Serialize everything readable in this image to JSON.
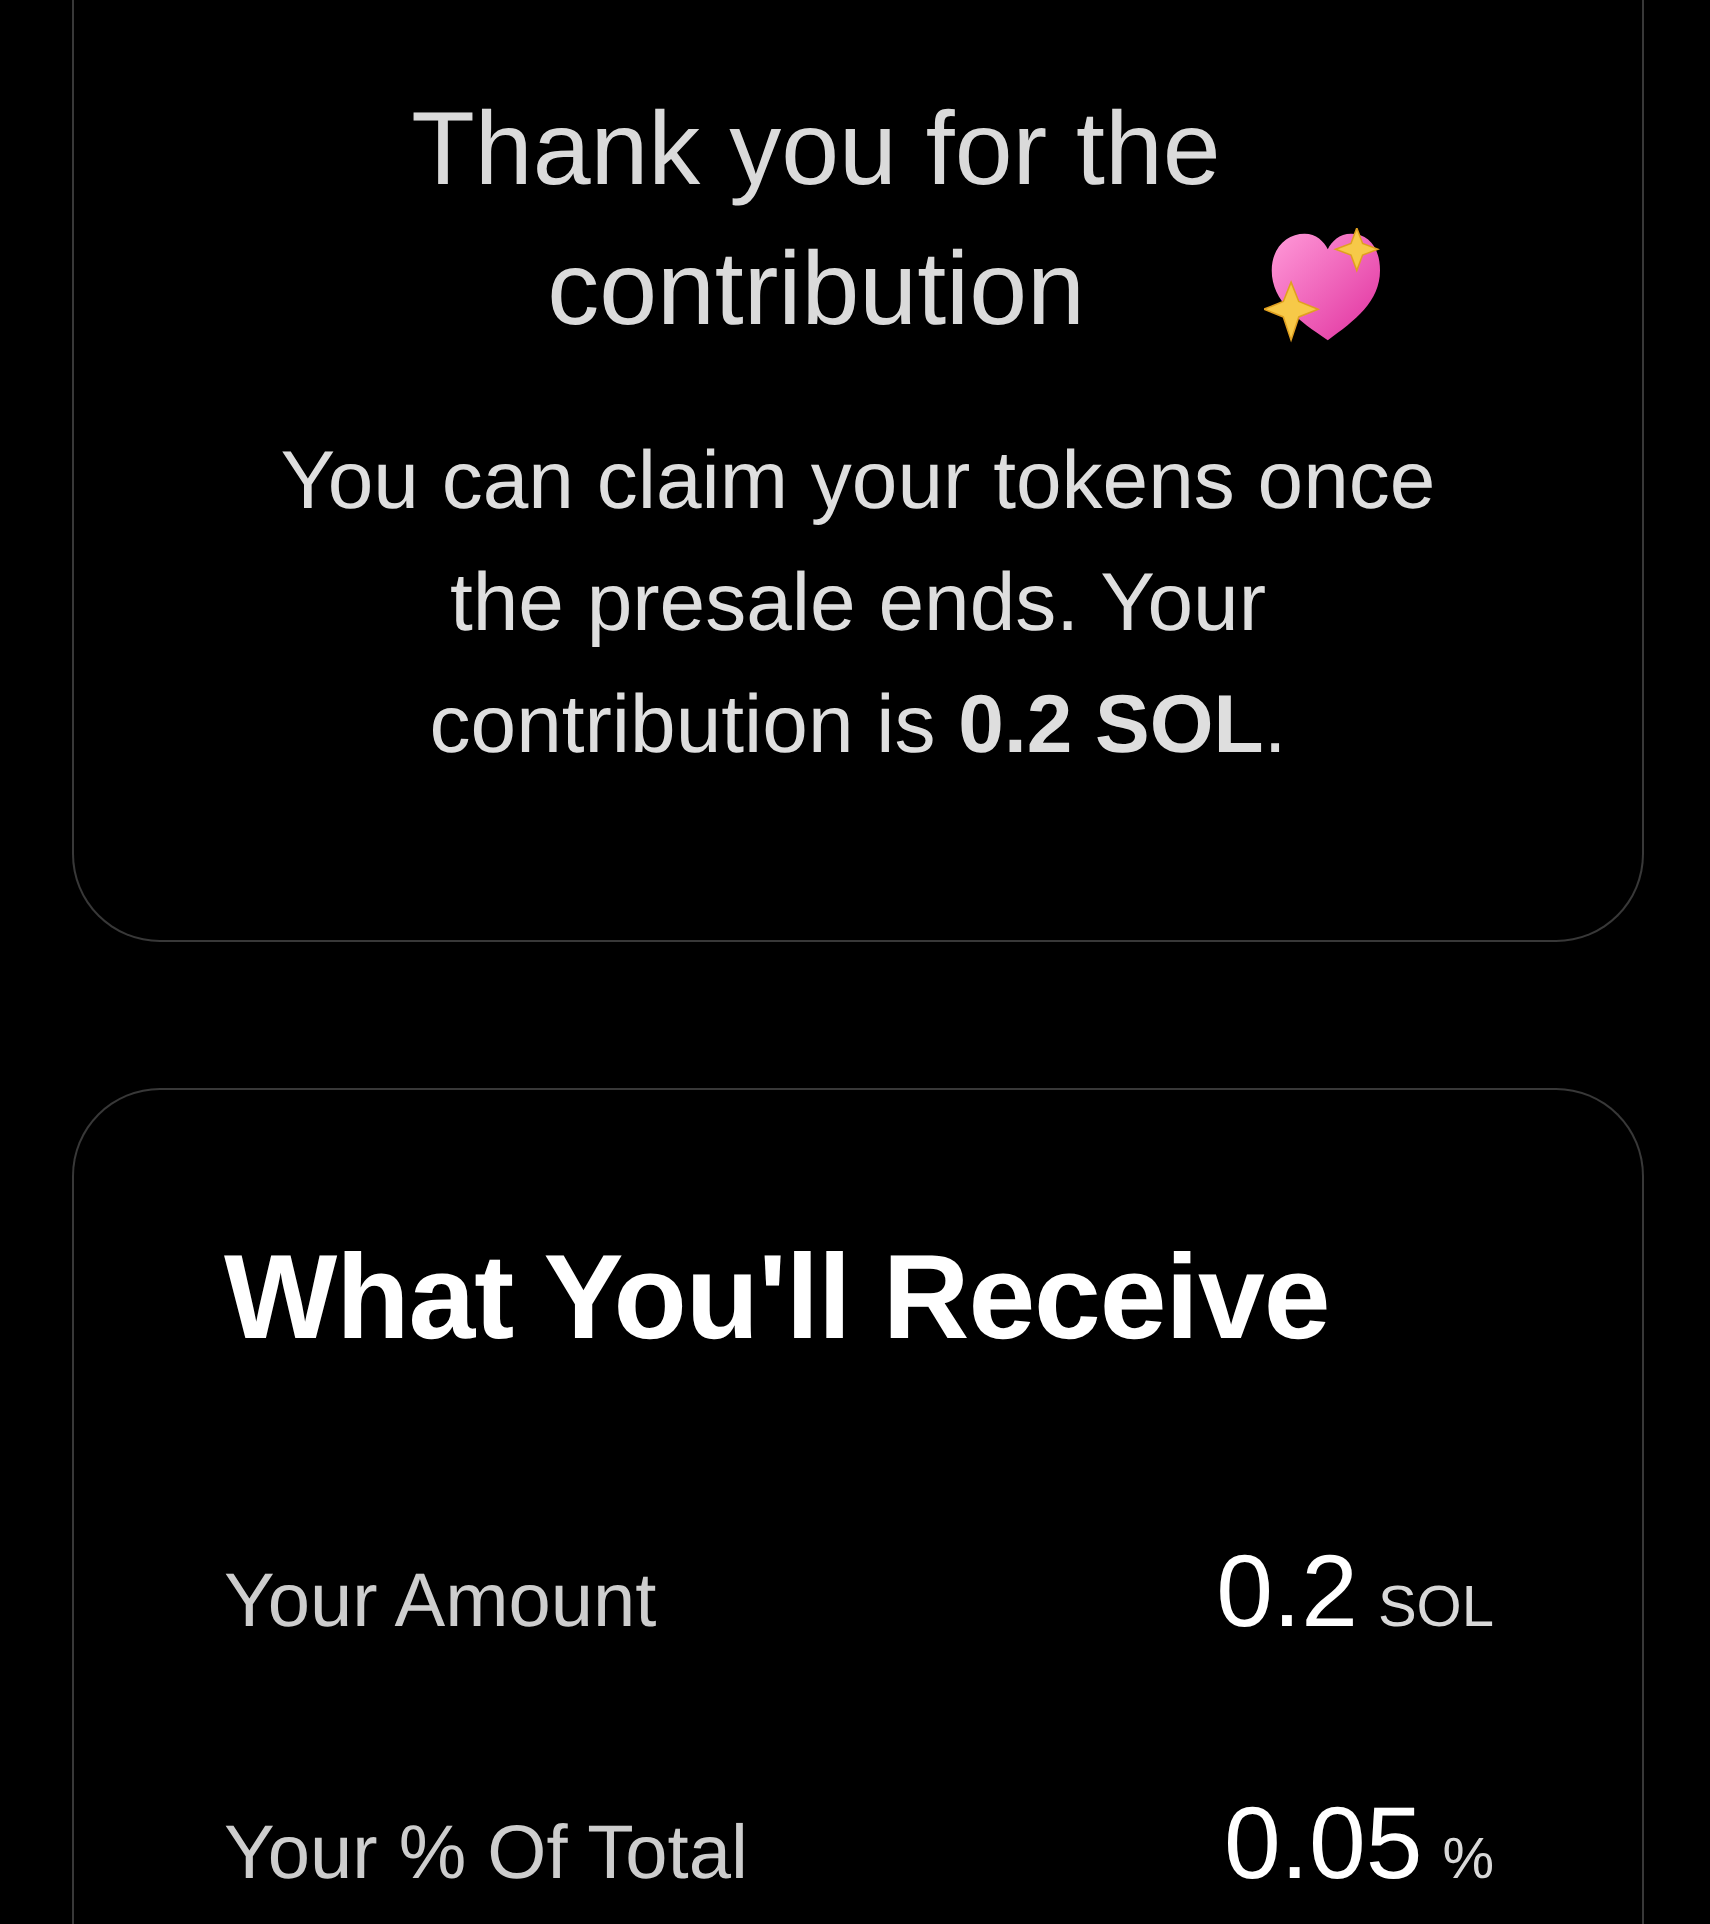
{
  "thank_you_card": {
    "title": "Thank you for the contribution",
    "message": "You can claim your tokens once the presale ends. Your contribution is **0.2 SOL**."
  },
  "receive_card": {
    "title": "What You'll Receive",
    "rows": [
      {
        "label": "Your Amount",
        "value": "0.2",
        "unit": "SOL"
      },
      {
        "label": "Your % Of Total",
        "value": "0.05",
        "unit": "%"
      }
    ]
  }
}
